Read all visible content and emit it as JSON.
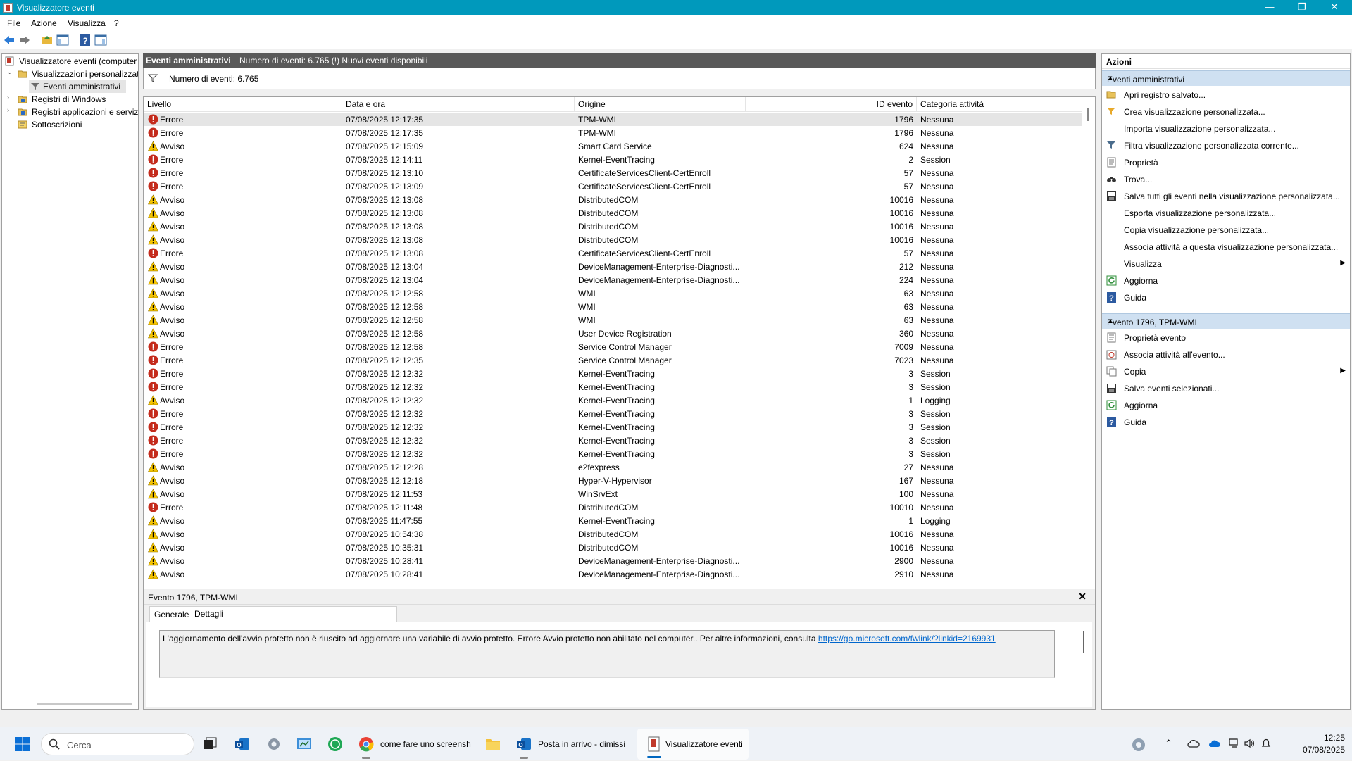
{
  "window": {
    "title": "Visualizzatore eventi",
    "controls": {
      "minimize": "—",
      "restore": "❐",
      "close": "✕"
    }
  },
  "menu": [
    "File",
    "Azione",
    "Visualizza",
    "?"
  ],
  "tree": {
    "items": [
      {
        "label": "Visualizzatore eventi (computer",
        "icon": "event-viewer-icon"
      },
      {
        "label": "Visualizzazioni personalizzate",
        "icon": "folder-icon"
      },
      {
        "label": "Eventi amministrativi",
        "icon": "filter-icon"
      },
      {
        "label": "Registri di Windows",
        "icon": "folder-icon"
      },
      {
        "label": "Registri applicazioni e servizi",
        "icon": "folder-icon"
      },
      {
        "label": "Sottoscrizioni",
        "icon": "subscription-icon"
      }
    ]
  },
  "center": {
    "header_title": "Eventi amministrativi",
    "header_info": "Numero di eventi: 6.765 (!) Nuovi eventi disponibili",
    "filter_text": "Numero di eventi: 6.765",
    "columns": [
      "Livello",
      "Data e ora",
      "Origine",
      "ID evento",
      "Categoria attività"
    ],
    "rows": [
      {
        "level": "Errore",
        "date": "07/08/2025 12:17:35",
        "source": "TPM-WMI",
        "id": "1796",
        "cat": "Nessuna"
      },
      {
        "level": "Errore",
        "date": "07/08/2025 12:17:35",
        "source": "TPM-WMI",
        "id": "1796",
        "cat": "Nessuna"
      },
      {
        "level": "Avviso",
        "date": "07/08/2025 12:15:09",
        "source": "Smart Card Service",
        "id": "624",
        "cat": "Nessuna"
      },
      {
        "level": "Errore",
        "date": "07/08/2025 12:14:11",
        "source": "Kernel-EventTracing",
        "id": "2",
        "cat": "Session"
      },
      {
        "level": "Errore",
        "date": "07/08/2025 12:13:10",
        "source": "CertificateServicesClient-CertEnroll",
        "id": "57",
        "cat": "Nessuna"
      },
      {
        "level": "Errore",
        "date": "07/08/2025 12:13:09",
        "source": "CertificateServicesClient-CertEnroll",
        "id": "57",
        "cat": "Nessuna"
      },
      {
        "level": "Avviso",
        "date": "07/08/2025 12:13:08",
        "source": "DistributedCOM",
        "id": "10016",
        "cat": "Nessuna"
      },
      {
        "level": "Avviso",
        "date": "07/08/2025 12:13:08",
        "source": "DistributedCOM",
        "id": "10016",
        "cat": "Nessuna"
      },
      {
        "level": "Avviso",
        "date": "07/08/2025 12:13:08",
        "source": "DistributedCOM",
        "id": "10016",
        "cat": "Nessuna"
      },
      {
        "level": "Avviso",
        "date": "07/08/2025 12:13:08",
        "source": "DistributedCOM",
        "id": "10016",
        "cat": "Nessuna"
      },
      {
        "level": "Errore",
        "date": "07/08/2025 12:13:08",
        "source": "CertificateServicesClient-CertEnroll",
        "id": "57",
        "cat": "Nessuna"
      },
      {
        "level": "Avviso",
        "date": "07/08/2025 12:13:04",
        "source": "DeviceManagement-Enterprise-Diagnosti...",
        "id": "212",
        "cat": "Nessuna"
      },
      {
        "level": "Avviso",
        "date": "07/08/2025 12:13:04",
        "source": "DeviceManagement-Enterprise-Diagnosti...",
        "id": "224",
        "cat": "Nessuna"
      },
      {
        "level": "Avviso",
        "date": "07/08/2025 12:12:58",
        "source": "WMI",
        "id": "63",
        "cat": "Nessuna"
      },
      {
        "level": "Avviso",
        "date": "07/08/2025 12:12:58",
        "source": "WMI",
        "id": "63",
        "cat": "Nessuna"
      },
      {
        "level": "Avviso",
        "date": "07/08/2025 12:12:58",
        "source": "WMI",
        "id": "63",
        "cat": "Nessuna"
      },
      {
        "level": "Avviso",
        "date": "07/08/2025 12:12:58",
        "source": "User Device Registration",
        "id": "360",
        "cat": "Nessuna"
      },
      {
        "level": "Errore",
        "date": "07/08/2025 12:12:58",
        "source": "Service Control Manager",
        "id": "7009",
        "cat": "Nessuna"
      },
      {
        "level": "Errore",
        "date": "07/08/2025 12:12:35",
        "source": "Service Control Manager",
        "id": "7023",
        "cat": "Nessuna"
      },
      {
        "level": "Errore",
        "date": "07/08/2025 12:12:32",
        "source": "Kernel-EventTracing",
        "id": "3",
        "cat": "Session"
      },
      {
        "level": "Errore",
        "date": "07/08/2025 12:12:32",
        "source": "Kernel-EventTracing",
        "id": "3",
        "cat": "Session"
      },
      {
        "level": "Avviso",
        "date": "07/08/2025 12:12:32",
        "source": "Kernel-EventTracing",
        "id": "1",
        "cat": "Logging"
      },
      {
        "level": "Errore",
        "date": "07/08/2025 12:12:32",
        "source": "Kernel-EventTracing",
        "id": "3",
        "cat": "Session"
      },
      {
        "level": "Errore",
        "date": "07/08/2025 12:12:32",
        "source": "Kernel-EventTracing",
        "id": "3",
        "cat": "Session"
      },
      {
        "level": "Errore",
        "date": "07/08/2025 12:12:32",
        "source": "Kernel-EventTracing",
        "id": "3",
        "cat": "Session"
      },
      {
        "level": "Errore",
        "date": "07/08/2025 12:12:32",
        "source": "Kernel-EventTracing",
        "id": "3",
        "cat": "Session"
      },
      {
        "level": "Avviso",
        "date": "07/08/2025 12:12:28",
        "source": "e2fexpress",
        "id": "27",
        "cat": "Nessuna"
      },
      {
        "level": "Avviso",
        "date": "07/08/2025 12:12:18",
        "source": "Hyper-V-Hypervisor",
        "id": "167",
        "cat": "Nessuna"
      },
      {
        "level": "Avviso",
        "date": "07/08/2025 12:11:53",
        "source": "WinSrvExt",
        "id": "100",
        "cat": "Nessuna"
      },
      {
        "level": "Errore",
        "date": "07/08/2025 12:11:48",
        "source": "DistributedCOM",
        "id": "10010",
        "cat": "Nessuna"
      },
      {
        "level": "Avviso",
        "date": "07/08/2025 11:47:55",
        "source": "Kernel-EventTracing",
        "id": "1",
        "cat": "Logging"
      },
      {
        "level": "Avviso",
        "date": "07/08/2025 10:54:38",
        "source": "DistributedCOM",
        "id": "10016",
        "cat": "Nessuna"
      },
      {
        "level": "Avviso",
        "date": "07/08/2025 10:35:31",
        "source": "DistributedCOM",
        "id": "10016",
        "cat": "Nessuna"
      },
      {
        "level": "Avviso",
        "date": "07/08/2025 10:28:41",
        "source": "DeviceManagement-Enterprise-Diagnosti...",
        "id": "2900",
        "cat": "Nessuna"
      },
      {
        "level": "Avviso",
        "date": "07/08/2025 10:28:41",
        "source": "DeviceManagement-Enterprise-Diagnosti...",
        "id": "2910",
        "cat": "Nessuna"
      }
    ]
  },
  "detail": {
    "title": "Evento 1796, TPM-WMI",
    "tabs": [
      "Generale",
      "Dettagli"
    ],
    "message": "L'aggiornamento dell'avvio protetto non è riuscito ad aggiornare una variabile di avvio protetto. Errore Avvio protetto non abilitato nel computer.. Per altre informazioni, consulta ",
    "link": "https://go.microsoft.com/fwlink/?linkid=2169931"
  },
  "actions": {
    "header": "Azioni",
    "section1": {
      "title": "Eventi amministrativi",
      "items": [
        {
          "label": "Apri registro salvato...",
          "icon": "open-folder-icon"
        },
        {
          "label": "Crea visualizzazione personalizzata...",
          "icon": "create-filter-icon"
        },
        {
          "label": "Importa visualizzazione personalizzata...",
          "icon": ""
        },
        {
          "label": "Filtra visualizzazione personalizzata corrente...",
          "icon": "filter-icon"
        },
        {
          "label": "Proprietà",
          "icon": "properties-icon"
        },
        {
          "label": "Trova...",
          "icon": "binoculars-icon"
        },
        {
          "label": "Salva tutti gli eventi nella visualizzazione personalizzata...",
          "icon": "save-icon"
        },
        {
          "label": "Esporta visualizzazione personalizzata...",
          "icon": ""
        },
        {
          "label": "Copia visualizzazione personalizzata...",
          "icon": ""
        },
        {
          "label": "Associa attività a questa visualizzazione personalizzata...",
          "icon": ""
        },
        {
          "label": "Visualizza",
          "icon": "",
          "submenu": true
        },
        {
          "label": "Aggiorna",
          "icon": "refresh-icon"
        },
        {
          "label": "Guida",
          "icon": "help-icon"
        }
      ]
    },
    "section2": {
      "title": "Evento 1796, TPM-WMI",
      "items": [
        {
          "label": "Proprietà evento",
          "icon": "properties-icon"
        },
        {
          "label": "Associa attività all'evento...",
          "icon": "task-icon"
        },
        {
          "label": "Copia",
          "icon": "copy-icon",
          "submenu": true
        },
        {
          "label": "Salva eventi selezionati...",
          "icon": "save-icon"
        },
        {
          "label": "Aggiorna",
          "icon": "refresh-icon"
        },
        {
          "label": "Guida",
          "icon": "help-icon"
        }
      ]
    }
  },
  "taskbar": {
    "search_placeholder": "Cerca",
    "apps": [
      {
        "label": "come fare uno screensh",
        "icon": "chrome-icon"
      },
      {
        "label": "Posta in arrivo - dimissi",
        "icon": "outlook-icon"
      },
      {
        "label": "Visualizzatore eventi",
        "icon": "event-viewer-icon"
      }
    ],
    "time": "12:25",
    "date": "07/08/2025"
  },
  "colors": {
    "titlebar": "#0099bc",
    "error": "#c42b1c",
    "warning": "#f5c400",
    "section": "#cfe0f1"
  }
}
